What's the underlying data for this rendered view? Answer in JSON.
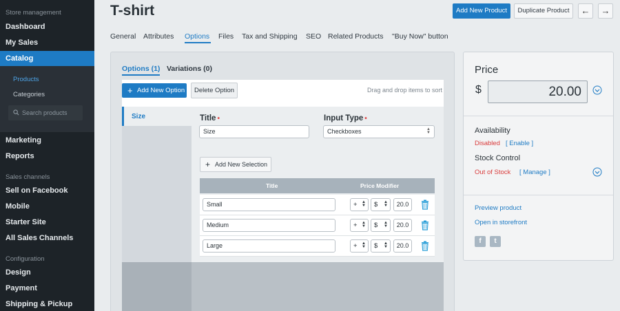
{
  "sidebar": {
    "sections": [
      {
        "heading": "Store management"
      },
      {
        "heading": "Sales channels"
      },
      {
        "heading": "Configuration"
      }
    ],
    "items": [
      {
        "label": "Dashboard"
      },
      {
        "label": "My Sales"
      },
      {
        "label": "Catalog"
      },
      {
        "label": "Marketing"
      },
      {
        "label": "Reports"
      },
      {
        "label": "Sell on Facebook"
      },
      {
        "label": "Mobile"
      },
      {
        "label": "Starter Site"
      },
      {
        "label": "All Sales Channels"
      },
      {
        "label": "Design"
      },
      {
        "label": "Payment"
      },
      {
        "label": "Shipping & Pickup"
      }
    ],
    "catalog_sub": [
      {
        "label": "Products"
      },
      {
        "label": "Categories"
      }
    ],
    "search_placeholder": "Search products"
  },
  "header": {
    "title": "T-shirt",
    "add_new_product": "Add New Product",
    "duplicate_product": "Duplicate Product",
    "prev_arrow": "←",
    "next_arrow": "→"
  },
  "tabs": [
    {
      "label": "General"
    },
    {
      "label": "Attributes"
    },
    {
      "label": "Options"
    },
    {
      "label": "Files"
    },
    {
      "label": "Tax and Shipping"
    },
    {
      "label": "SEO"
    },
    {
      "label": "Related Products"
    },
    {
      "label": "\"Buy Now\" button"
    }
  ],
  "options_panel": {
    "subtabs": [
      {
        "label": "Options (1)"
      },
      {
        "label": "Variations (0)"
      }
    ],
    "add_new_option": "Add New Option",
    "delete_option": "Delete Option",
    "drag_hint": "Drag and drop items to sort",
    "option_list": [
      {
        "label": "Size"
      }
    ],
    "title_label": "Title",
    "title_value": "Size",
    "input_type_label": "Input Type",
    "input_type_value": "Checkboxes",
    "required_mark": "•",
    "add_new_selection": "Add New Selection",
    "columns": {
      "title": "Title",
      "price_modifier": "Price Modifier"
    },
    "selections": [
      {
        "name": "Small",
        "sign": "+",
        "unit": "$",
        "value": "20.0"
      },
      {
        "name": "Medium",
        "sign": "+",
        "unit": "$",
        "value": "20.0"
      },
      {
        "name": "Large",
        "sign": "+",
        "unit": "$",
        "value": "20.0"
      }
    ]
  },
  "right_panel": {
    "price_heading": "Price",
    "currency": "$",
    "price_value": "20.00",
    "availability_label": "Availability",
    "availability_status": "Disabled",
    "enable_link": "[ Enable ]",
    "stock_label": "Stock Control",
    "stock_status": "Out of Stock",
    "manage_link": "[ Manage ]",
    "preview_link": "Preview product",
    "storefront_link": "Open in storefront",
    "social": {
      "facebook": "f",
      "twitter": "t"
    }
  },
  "colors": {
    "accent": "#1e7bc4",
    "sidebar_bg": "#1d2328",
    "error": "#d93b3b"
  }
}
